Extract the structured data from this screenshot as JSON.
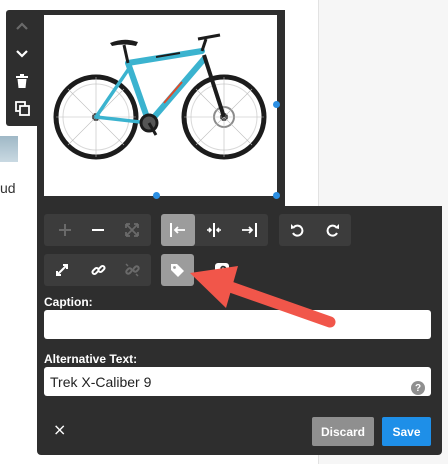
{
  "background": {
    "text_fragment": "ud"
  },
  "image": {
    "alt_preview": "Trek X-Caliber 9 bicycle",
    "colors": {
      "frame": "#3bb3cf",
      "accent": "#1c1c1c"
    }
  },
  "editor": {
    "caption_label": "Caption:",
    "caption_value": "",
    "alt_label": "Alternative Text:",
    "alt_value": "Trek X-Caliber 9",
    "help_glyph": "?",
    "discard_label": "Discard",
    "save_label": "Save",
    "close_glyph": "×"
  },
  "toolbar": {
    "active_tool": "tag",
    "icons": [
      "add-icon",
      "remove-icon",
      "fit-icon",
      "align-left-icon",
      "align-center-icon",
      "align-right-icon",
      "undo-icon",
      "redo-icon",
      "expand-icon",
      "link-icon",
      "unlink-icon",
      "tag-icon",
      "pinterest-icon"
    ]
  },
  "colors": {
    "panel": "#2e2e2e",
    "active": "#9c9c9c",
    "save": "#1e8fe8",
    "discard": "#8f8f8f",
    "annotation_arrow": "#f1564a",
    "handle": "#2b8fe3"
  }
}
